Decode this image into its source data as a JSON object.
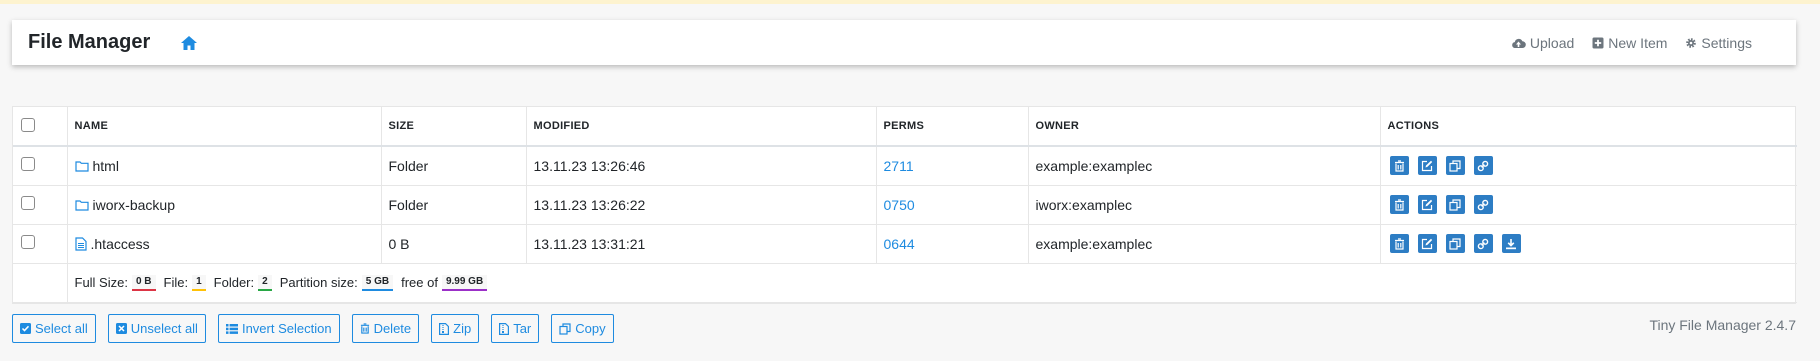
{
  "header": {
    "title": "File Manager",
    "nav": [
      {
        "label": "Upload",
        "icon": "cloud-upload-icon"
      },
      {
        "label": "New Item",
        "icon": "plus-square-icon"
      },
      {
        "label": "Settings",
        "icon": "gear-icon"
      }
    ]
  },
  "table": {
    "columns": [
      "NAME",
      "SIZE",
      "MODIFIED",
      "PERMS",
      "OWNER",
      "ACTIONS"
    ],
    "rows": [
      {
        "name": "html",
        "type": "folder",
        "size": "Folder",
        "modified": "13.11.23 13:26:46",
        "perms": "2711",
        "owner": "example:examplec"
      },
      {
        "name": "iworx-backup",
        "type": "folder",
        "size": "Folder",
        "modified": "13.11.23 13:26:22",
        "perms": "0750",
        "owner": "iworx:examplec"
      },
      {
        "name": ".htaccess",
        "type": "file",
        "size": "0 B",
        "modified": "13.11.23 13:31:21",
        "perms": "0644",
        "owner": "example:examplec"
      }
    ],
    "summary": {
      "full_size_label": "Full Size:",
      "full_size": "0 B",
      "file_label": "File:",
      "file_count": "1",
      "folder_label": "Folder:",
      "folder_count": "2",
      "partition_label": "Partition size:",
      "partition_size": "5 GB",
      "free_label": "free of",
      "total_size": "9.99 GB"
    }
  },
  "bottom_buttons": {
    "select_all": "Select all",
    "unselect_all": "Unselect all",
    "invert_selection": "Invert Selection",
    "delete": "Delete",
    "zip": "Zip",
    "tar": "Tar",
    "copy": "Copy"
  },
  "version": "Tiny File Manager 2.4.7",
  "colors": {
    "accent": "#1e8be0",
    "action_button": "#2d7dc4",
    "banner": "#fdf3cf"
  }
}
